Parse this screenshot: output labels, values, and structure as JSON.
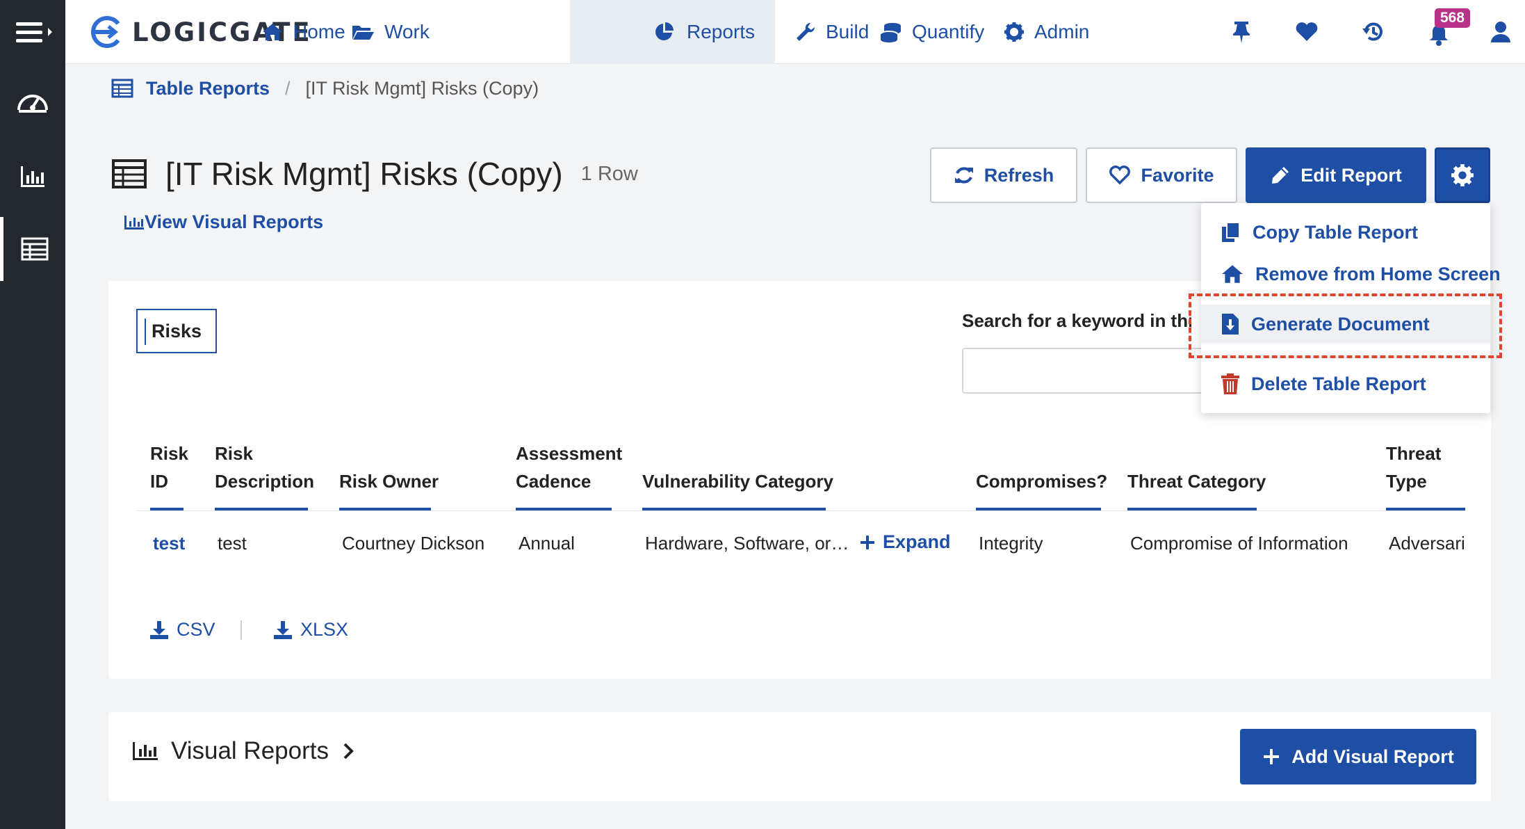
{
  "app": {
    "logo_text": "LOGICGATE",
    "notification_count": "568"
  },
  "nav": {
    "items": [
      {
        "label": "Home",
        "icon": "home-icon"
      },
      {
        "label": "Work",
        "icon": "folder-open-icon"
      },
      {
        "label": "Reports",
        "icon": "pie-chart-icon",
        "active": true
      },
      {
        "label": "Build",
        "icon": "wrench-icon"
      },
      {
        "label": "Quantify",
        "icon": "coins-icon"
      },
      {
        "label": "Admin",
        "icon": "gear-icon"
      }
    ]
  },
  "breadcrumb": {
    "parent": "Table Reports",
    "separator": "/",
    "current": "[IT Risk Mgmt] Risks (Copy)"
  },
  "header": {
    "title": "[IT Risk Mgmt] Risks (Copy)",
    "row_count": "1 Row",
    "view_visual_reports": "View Visual Reports",
    "refresh_label": "Refresh",
    "favorite_label": "Favorite",
    "edit_label": "Edit Report"
  },
  "dropdown": {
    "items": [
      {
        "label": "Copy Table Report",
        "icon": "copy-icon"
      },
      {
        "label": "Remove from Home Screen",
        "icon": "home-icon"
      },
      {
        "label": "Generate Document",
        "icon": "file-download-icon",
        "highlighted": true
      },
      {
        "label": "Delete Table Report",
        "icon": "trash-icon",
        "color": "#c0392b"
      }
    ]
  },
  "table": {
    "tab_label": "Risks",
    "search_label": "Search for a keyword in this table",
    "search_value": "",
    "columns": [
      {
        "line1": "Risk",
        "line2": "ID"
      },
      {
        "line1": "Risk",
        "line2": "Description"
      },
      {
        "line1": "",
        "line2": "Risk Owner"
      },
      {
        "line1": "Assessment",
        "line2": "Cadence"
      },
      {
        "line1": "",
        "line2": "Vulnerability Category"
      },
      {
        "line1": "",
        "line2": "Compromises?"
      },
      {
        "line1": "",
        "line2": "Threat Category"
      },
      {
        "line1": "Threat",
        "line2": "Type"
      }
    ],
    "rows": [
      {
        "risk_id": "test",
        "risk_description": "test",
        "risk_owner": "Courtney Dickson",
        "assessment_cadence": "Annual",
        "vulnerability_category": "Hardware, Software, or…",
        "expand_label": "Expand",
        "compromises": "Integrity",
        "threat_category": "Compromise of Information",
        "threat_type": "Adversarial"
      }
    ],
    "export_csv": "CSV",
    "export_xlsx": "XLSX"
  },
  "visual_reports": {
    "title": "Visual Reports",
    "add_label": "Add Visual Report"
  },
  "colors": {
    "accent": "#1e4fa5",
    "rail": "#23282f",
    "badge": "#b7338a",
    "danger": "#c0392b",
    "highlight": "#e2452d"
  }
}
